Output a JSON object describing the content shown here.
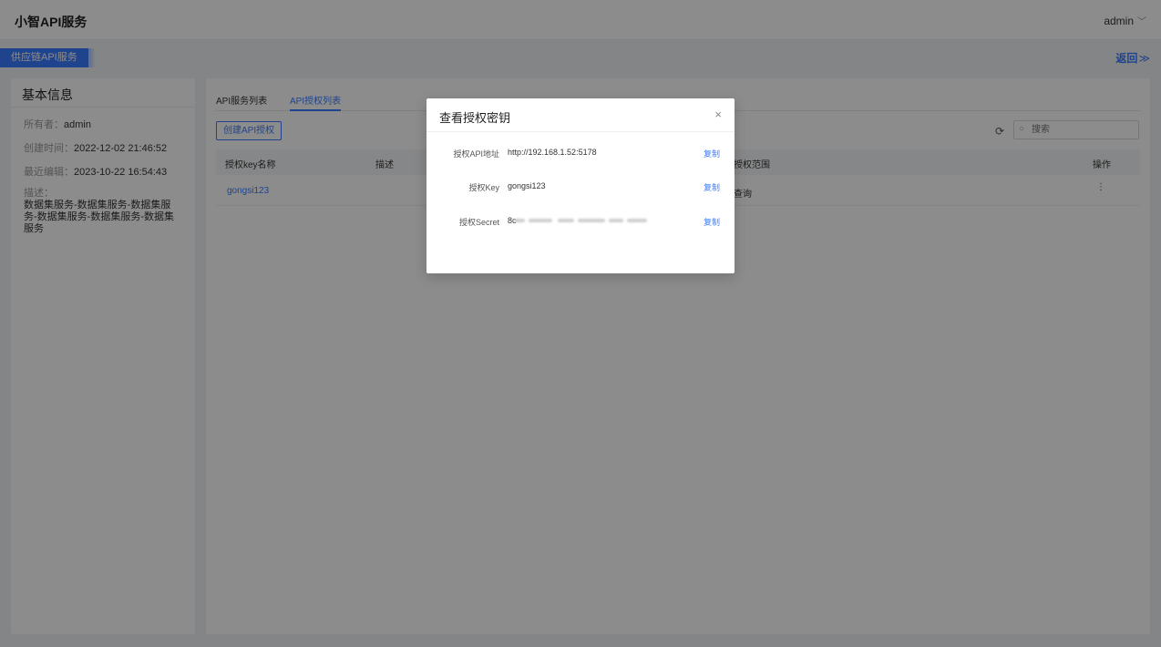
{
  "header": {
    "app_title": "小智API服务",
    "user": "admin"
  },
  "subbar": {
    "project_name": "供应链API服务",
    "back_label": "返回",
    "back_arrow": "≫"
  },
  "info_panel": {
    "title": "基本信息",
    "owner_label": "所有者：",
    "owner": "admin",
    "created_label": "创建时间：",
    "created": "2022-12-02 21:46:52",
    "edited_label": "最近编辑：",
    "edited": "2023-10-22 16:54:43",
    "desc_label": "描述：",
    "desc": "数据集服务-数据集服务-数据集服务-数据集服务-数据集服务-数据集服务"
  },
  "main": {
    "tabs": [
      {
        "label": "API服务列表",
        "active": false
      },
      {
        "label": "API授权列表",
        "active": true
      }
    ],
    "create_button": "创建API授权",
    "search": {
      "placeholder": "搜索",
      "value": ""
    },
    "table": {
      "columns": [
        "授权key名称",
        "描述",
        "授权范围",
        "操作"
      ],
      "rows": [
        {
          "name": "gongsi123",
          "desc": "",
          "scope": "查询",
          "action": "⋮"
        }
      ]
    }
  },
  "modal": {
    "title": "查看授权密钥",
    "close_glyph": "×",
    "fields": [
      {
        "label": "授权API地址",
        "value": "http://192.168.1.52:5178",
        "copy": "复制"
      },
      {
        "label": "授权Key",
        "value": "gongsi123",
        "copy": "复制"
      },
      {
        "label": "授权Secret",
        "value": "8c",
        "copy": "复制",
        "masked": true
      }
    ]
  },
  "icons": {
    "refresh": "refresh-icon",
    "search": "search-icon",
    "close": "close-icon",
    "chevron": "chevron-down-icon"
  },
  "colors": {
    "accent": "#3a7bff",
    "mask": "rgba(0,0,0,0.45)"
  }
}
